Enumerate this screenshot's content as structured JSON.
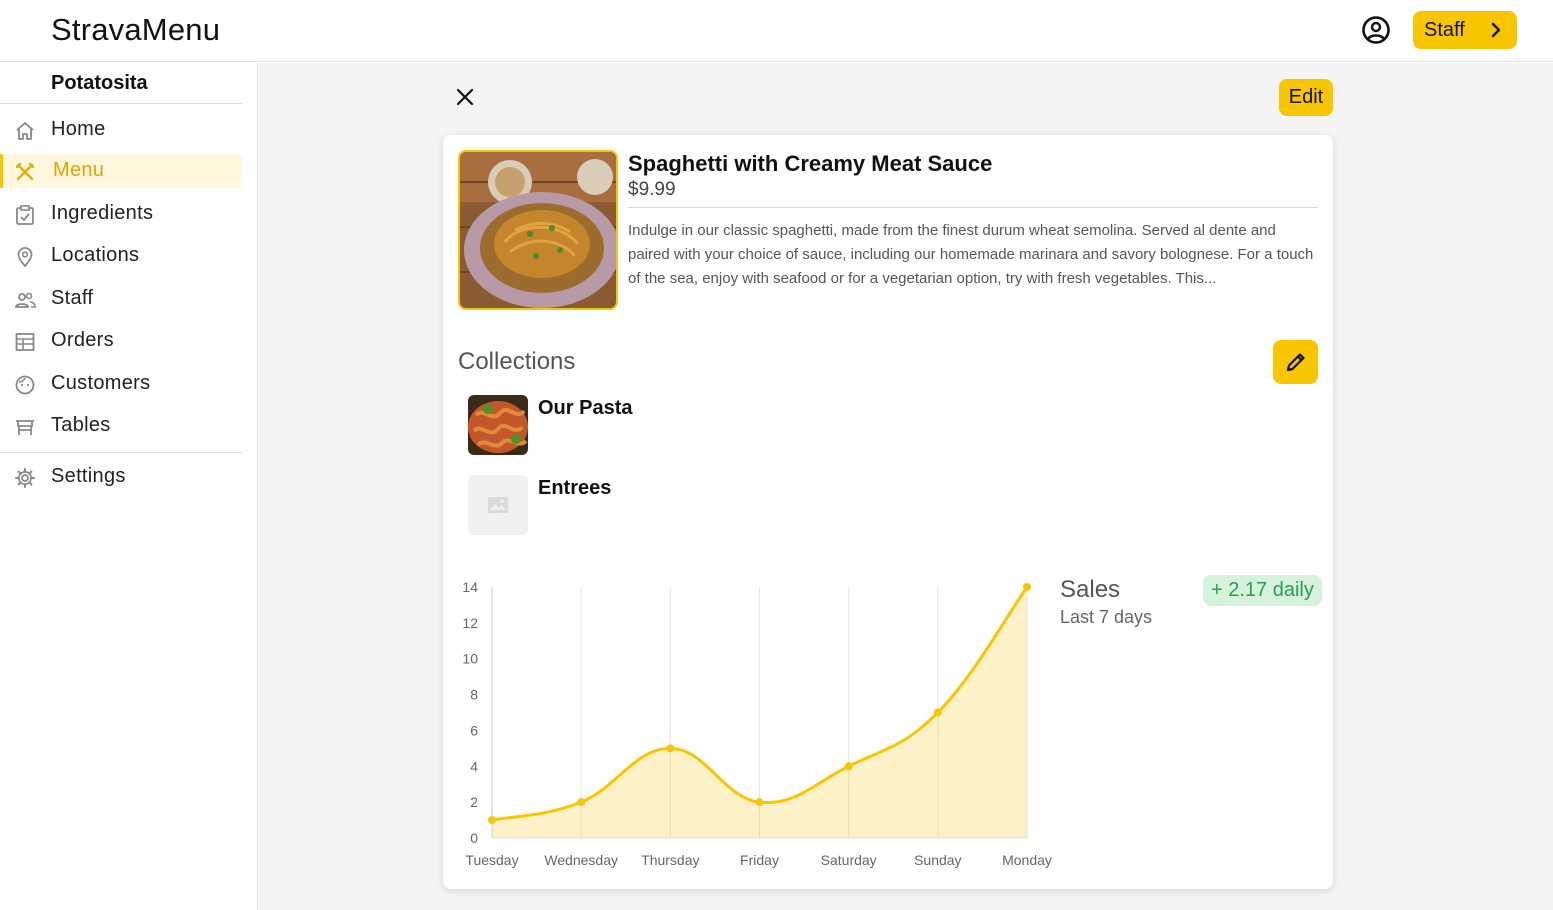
{
  "app": {
    "title": "StravaMenu"
  },
  "header": {
    "staff_label": "Staff",
    "account_icon": "account-circle-icon"
  },
  "sidebar": {
    "restaurant": "Potatosita",
    "items": [
      {
        "label": "Home",
        "icon": "home-icon"
      },
      {
        "label": "Menu",
        "icon": "utensils-icon",
        "active": true
      },
      {
        "label": "Ingredients",
        "icon": "clipboard-check-icon"
      },
      {
        "label": "Locations",
        "icon": "location-pin-icon"
      },
      {
        "label": "Staff",
        "icon": "people-icon"
      },
      {
        "label": "Orders",
        "icon": "orders-icon"
      },
      {
        "label": "Customers",
        "icon": "face-icon"
      },
      {
        "label": "Tables",
        "icon": "table-icon"
      },
      {
        "label": "Settings",
        "icon": "gear-icon"
      }
    ]
  },
  "toolbar": {
    "edit_label": "Edit"
  },
  "dish": {
    "name": "Spaghetti with Creamy Meat Sauce",
    "price": "$9.99",
    "description": "Indulge in our classic spaghetti, made from the finest durum wheat semolina. Served al dente and paired with your choice of sauce, including our homemade marinara and savory bolognese. For a touch of the sea, enjoy with seafood or for a vegetarian option, try with fresh vegetables. This..."
  },
  "collections": {
    "title": "Collections",
    "items": [
      {
        "name": "Our Pasta"
      },
      {
        "name": "Entrees"
      }
    ]
  },
  "sales": {
    "title": "Sales",
    "subtitle": "Last 7 days",
    "badge": "+ 2.17 daily"
  },
  "colors": {
    "accent": "#f7c600",
    "positive": "#2e9b4e",
    "positive_bg": "#d4f2dc"
  },
  "chart_data": {
    "type": "area",
    "categories": [
      "Tuesday",
      "Wednesday",
      "Thursday",
      "Friday",
      "Saturday",
      "Sunday",
      "Monday"
    ],
    "series": [
      {
        "values": [
          1,
          2,
          5,
          2,
          4,
          7,
          14
        ]
      }
    ],
    "ylim": [
      0,
      14
    ],
    "yticks": [
      0,
      2,
      4,
      6,
      8,
      10,
      12,
      14
    ],
    "grid": "vertical",
    "color": "#f7c600"
  }
}
